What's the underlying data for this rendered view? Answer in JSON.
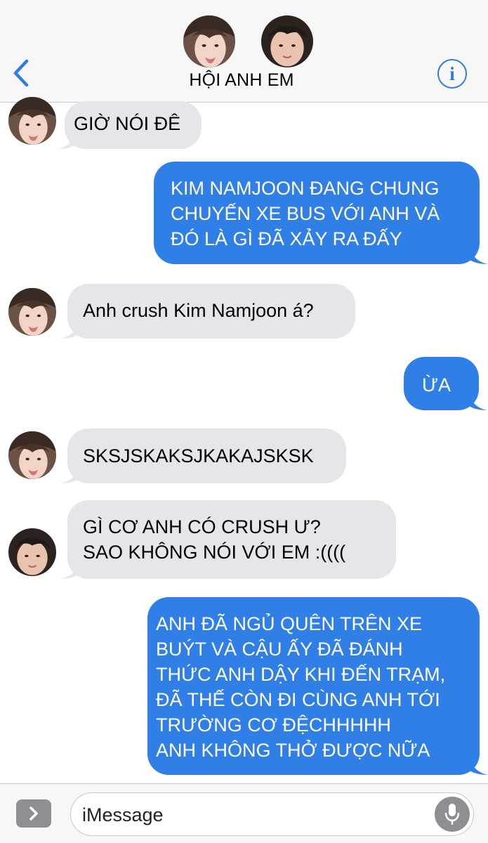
{
  "header": {
    "title": "HỘI ANH EM",
    "back_icon": "chevron-left-icon",
    "info_icon": "info-icon",
    "info_glyph": "i",
    "accent_color": "#2f7de1"
  },
  "messages": [
    {
      "sender": "friend-1",
      "direction": "incoming",
      "text": "GIỜ NÓI ĐÊ"
    },
    {
      "sender": "me",
      "direction": "outgoing",
      "text": "KIM NAMJOON ĐANG CHUNG\nCHUYẾN XE BUS VỚI ANH VÀ\nĐÓ LÀ GÌ ĐÃ XẢY RA ĐẤY"
    },
    {
      "sender": "friend-1",
      "direction": "incoming",
      "text": "Anh crush Kim Namjoon á?"
    },
    {
      "sender": "me",
      "direction": "outgoing",
      "text": "ỪA"
    },
    {
      "sender": "friend-1",
      "direction": "incoming",
      "text": "SKSJSKAKSJKAKAJSKSK"
    },
    {
      "sender": "friend-2",
      "direction": "incoming",
      "text": "GÌ CƠ ANH CÓ CRUSH Ư?\nSAO KHÔNG NÓI VỚI EM :(((("
    },
    {
      "sender": "me",
      "direction": "outgoing",
      "text": "ANH ĐÃ NGỦ QUÊN TRÊN XE\nBUÝT VÀ CẬU ẤY ĐÃ ĐÁNH\nTHỨC ANH DẬY KHI ĐẾN TRẠM,\nĐÃ THẾ CÒN ĐI CÙNG ANH TỚI\nTRƯỜNG CƠ ĐỆCHHHHH\nANH KHÔNG THỞ ĐƯỢC NỮA"
    }
  ],
  "input_bar": {
    "placeholder": "iMessage",
    "apps_icon": "chevron-right-icon",
    "mic_icon": "microphone-icon"
  },
  "colors": {
    "incoming_bubble": "#e5e5ea",
    "outgoing_bubble": "#2f7fe6",
    "header_bg": "#f7f7f7"
  }
}
